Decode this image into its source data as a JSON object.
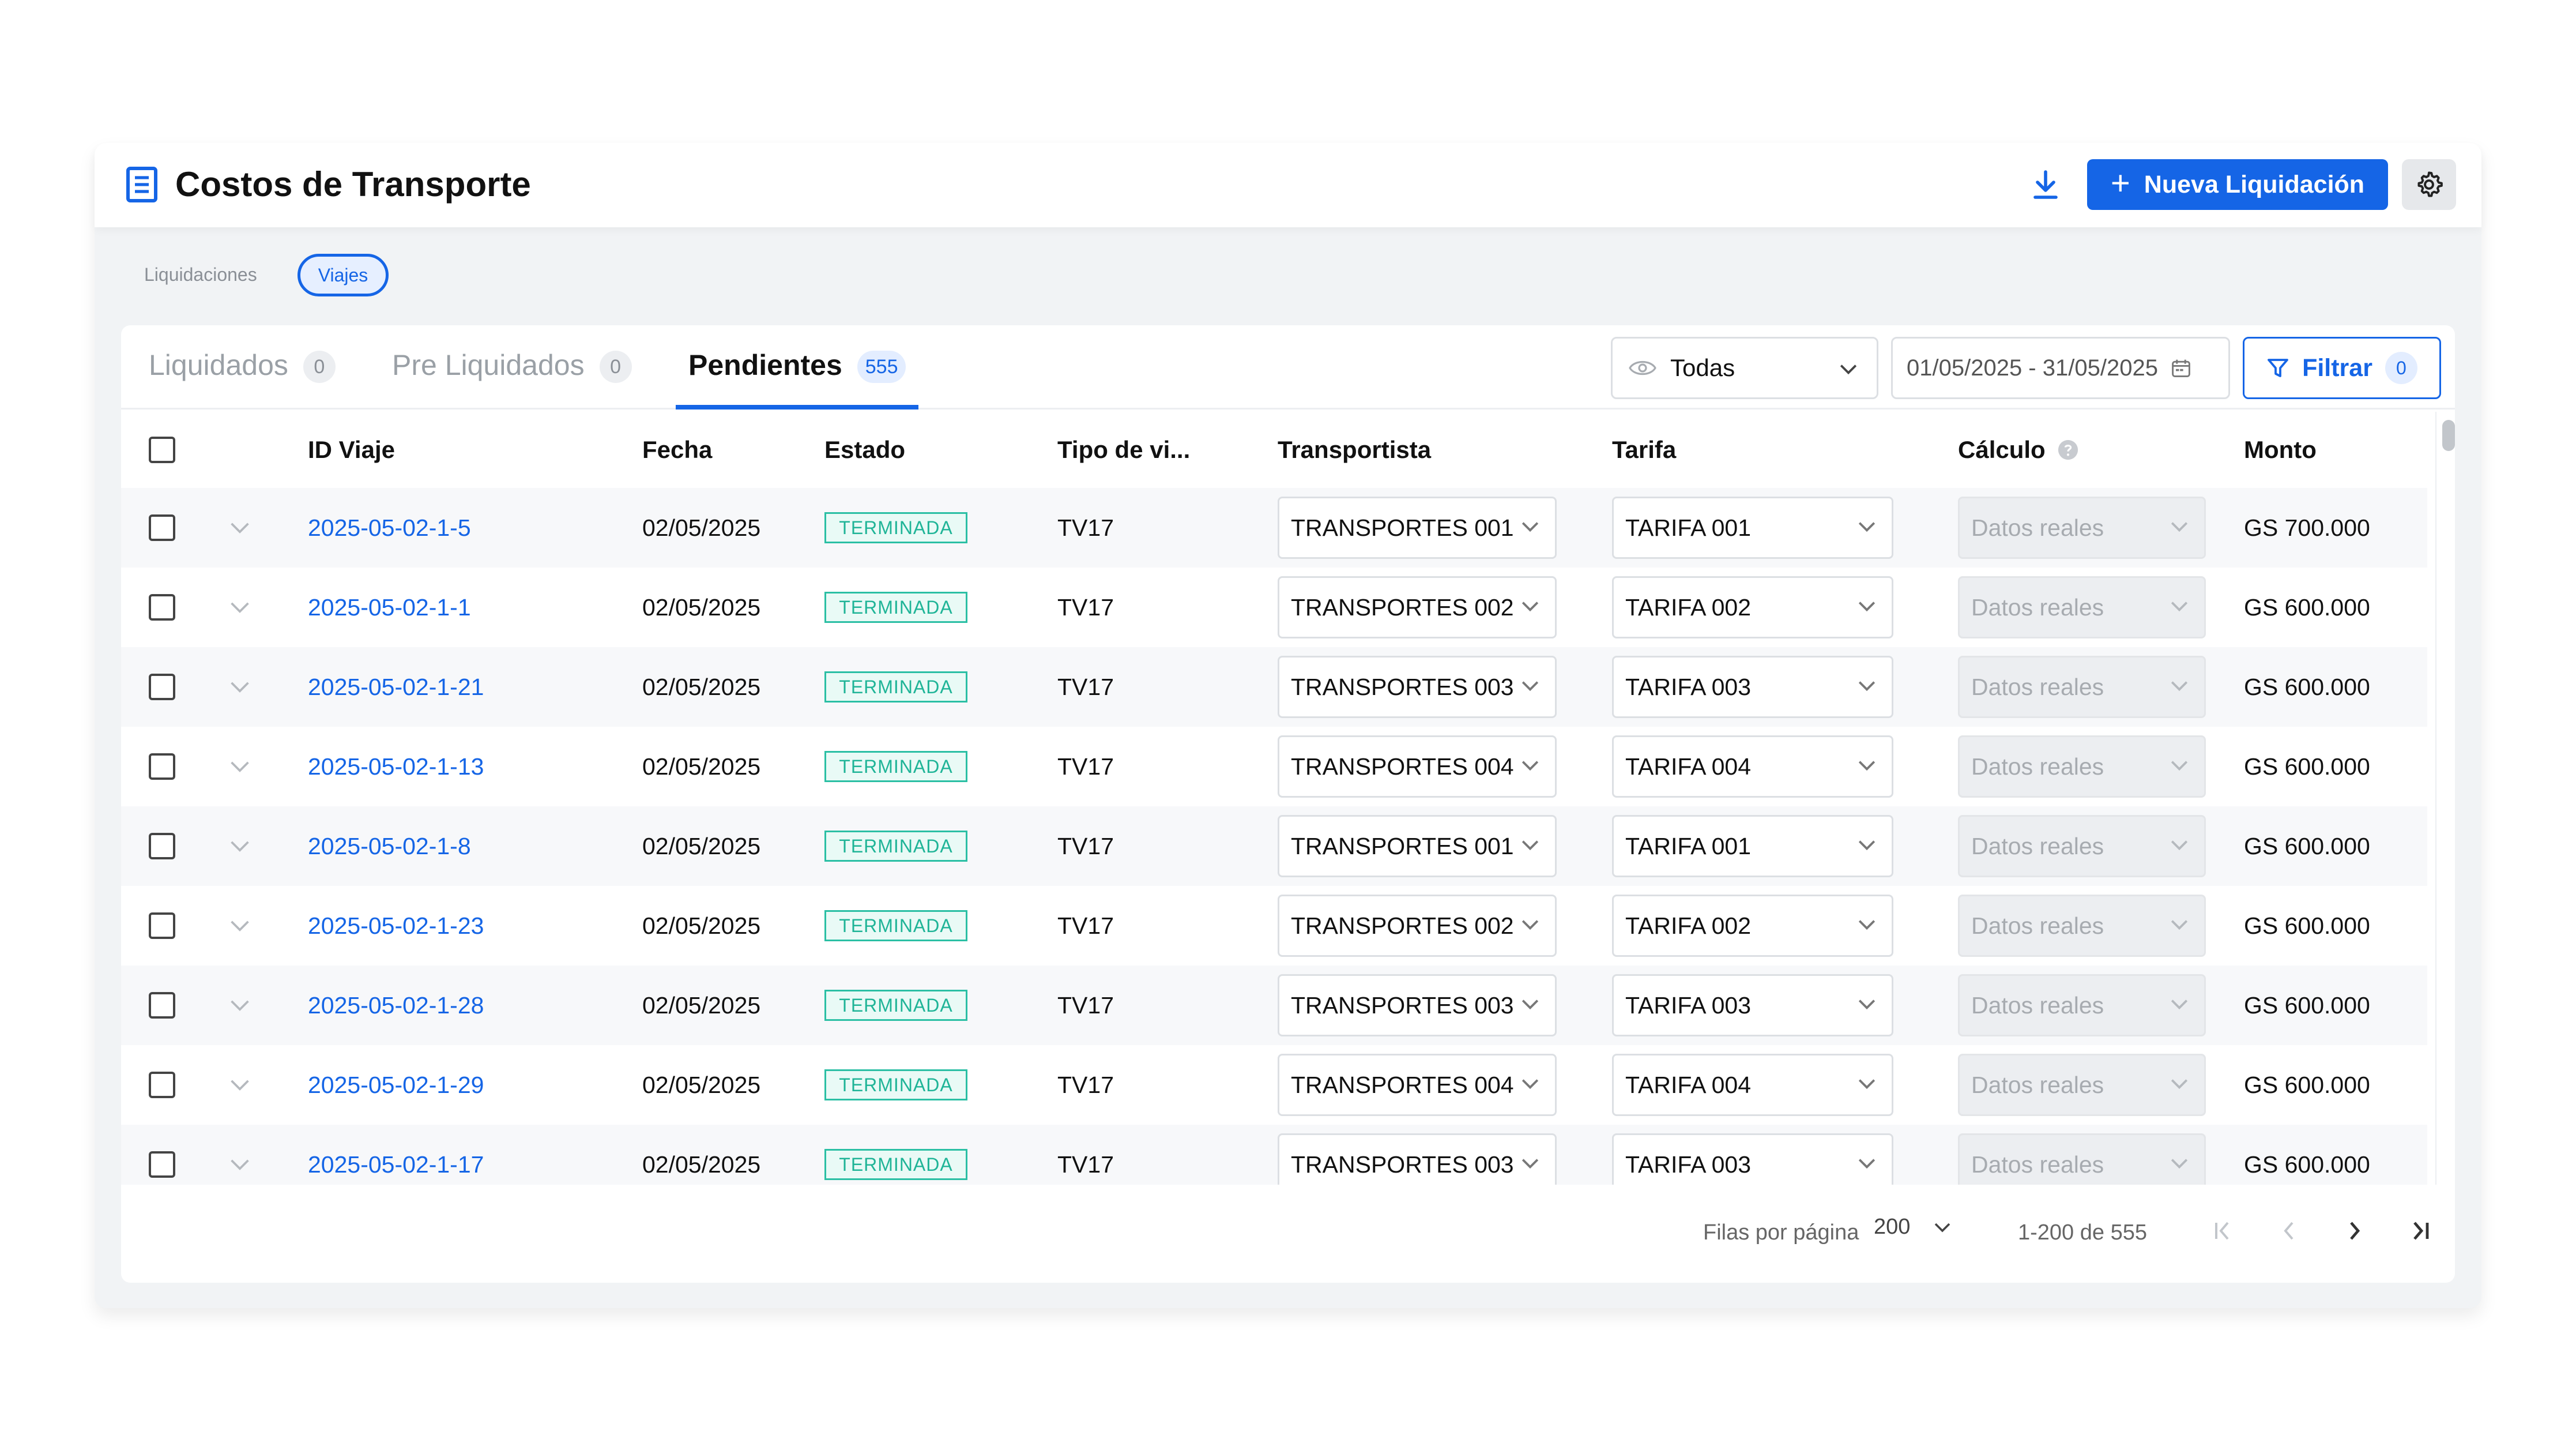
{
  "header": {
    "title": "Costos de Transporte",
    "new_button_label": "Nueva Liquidación",
    "icons": [
      "document-list-icon",
      "download-icon",
      "plus-icon",
      "gear-icon"
    ]
  },
  "subnav": {
    "items": [
      "Liquidaciones",
      "Viajes"
    ],
    "active": "Viajes"
  },
  "tabs": [
    {
      "label": "Liquidados",
      "count": "0"
    },
    {
      "label": "Pre Liquidados",
      "count": "0"
    },
    {
      "label": "Pendientes",
      "count": "555"
    }
  ],
  "active_tab": "Pendientes",
  "toolbar": {
    "visibility_value": "Todas",
    "date_range": "01/05/2025 - 31/05/2025",
    "filter_label": "Filtrar",
    "filter_count": "0"
  },
  "table": {
    "columns": [
      "ID Viaje",
      "Fecha",
      "Estado",
      "Tipo de vi...",
      "Transportista",
      "Tarifa",
      "Cálculo",
      "Monto"
    ],
    "rows": [
      {
        "id": "2025-05-02-1-5",
        "fecha": "02/05/2025",
        "estado": "TERMINADA",
        "tipo": "TV17",
        "transportista": "TRANSPORTES 001",
        "tarifa": "TARIFA 001",
        "calculo": "Datos reales",
        "monto": "GS 700.000"
      },
      {
        "id": "2025-05-02-1-1",
        "fecha": "02/05/2025",
        "estado": "TERMINADA",
        "tipo": "TV17",
        "transportista": "TRANSPORTES 002",
        "tarifa": "TARIFA 002",
        "calculo": "Datos reales",
        "monto": "GS 600.000"
      },
      {
        "id": "2025-05-02-1-21",
        "fecha": "02/05/2025",
        "estado": "TERMINADA",
        "tipo": "TV17",
        "transportista": "TRANSPORTES 003",
        "tarifa": "TARIFA 003",
        "calculo": "Datos reales",
        "monto": "GS 600.000"
      },
      {
        "id": "2025-05-02-1-13",
        "fecha": "02/05/2025",
        "estado": "TERMINADA",
        "tipo": "TV17",
        "transportista": "TRANSPORTES 004",
        "tarifa": "TARIFA 004",
        "calculo": "Datos reales",
        "monto": "GS 600.000"
      },
      {
        "id": "2025-05-02-1-8",
        "fecha": "02/05/2025",
        "estado": "TERMINADA",
        "tipo": "TV17",
        "transportista": "TRANSPORTES 001",
        "tarifa": "TARIFA 001",
        "calculo": "Datos reales",
        "monto": "GS 600.000"
      },
      {
        "id": "2025-05-02-1-23",
        "fecha": "02/05/2025",
        "estado": "TERMINADA",
        "tipo": "TV17",
        "transportista": "TRANSPORTES 002",
        "tarifa": "TARIFA 002",
        "calculo": "Datos reales",
        "monto": "GS 600.000"
      },
      {
        "id": "2025-05-02-1-28",
        "fecha": "02/05/2025",
        "estado": "TERMINADA",
        "tipo": "TV17",
        "transportista": "TRANSPORTES 003",
        "tarifa": "TARIFA 003",
        "calculo": "Datos reales",
        "monto": "GS 600.000"
      },
      {
        "id": "2025-05-02-1-29",
        "fecha": "02/05/2025",
        "estado": "TERMINADA",
        "tipo": "TV17",
        "transportista": "TRANSPORTES 004",
        "tarifa": "TARIFA 004",
        "calculo": "Datos reales",
        "monto": "GS 600.000"
      },
      {
        "id": "2025-05-02-1-17",
        "fecha": "02/05/2025",
        "estado": "TERMINADA",
        "tipo": "TV17",
        "transportista": "TRANSPORTES 003",
        "tarifa": "TARIFA 003",
        "calculo": "Datos reales",
        "monto": "GS 600.000"
      }
    ]
  },
  "footer": {
    "rows_per_page_label": "Filas por página",
    "rows_per_page": "200",
    "range": "1-200 de 555"
  },
  "colors": {
    "primary": "#1565e6",
    "status_terminada": "#1fb497",
    "background": "#f1f3f5"
  }
}
